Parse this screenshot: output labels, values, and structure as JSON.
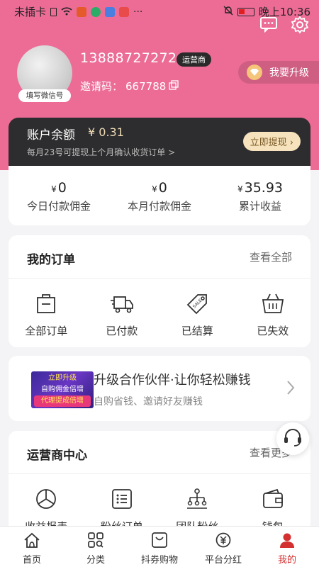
{
  "status": {
    "carrier": "未插卡",
    "battery_time": "晚上10:36"
  },
  "profile": {
    "wechat_tag": "填写微信号",
    "phone": "13888727272",
    "role": "运营商",
    "invite_label": "邀请码：",
    "invite_code": "667788",
    "upgrade_label": "我要升级"
  },
  "balance": {
    "title": "账户余额",
    "amount": "¥ 0.31",
    "note": "每月23号可提现上个月确认收货订单 >",
    "withdraw_label": "立即提现"
  },
  "earnings": [
    {
      "currency": "¥",
      "value": "0",
      "label": "今日付款佣金"
    },
    {
      "currency": "¥",
      "value": "0",
      "label": "本月付款佣金"
    },
    {
      "currency": "¥",
      "value": "35.93",
      "label": "累计收益"
    }
  ],
  "orders": {
    "title": "我的订单",
    "more": "查看全部",
    "items": [
      {
        "label": "全部订单",
        "icon": "bag-icon"
      },
      {
        "label": "已付款",
        "icon": "truck-icon"
      },
      {
        "label": "已结算",
        "icon": "sale-tag-icon"
      },
      {
        "label": "已失效",
        "icon": "basket-icon"
      }
    ]
  },
  "promo": {
    "img_line1": "立即升级",
    "img_line2": "自购佣金倍增",
    "img_line3": "代理提成倍增",
    "title": "升级合作伙伴·让你轻松赚钱",
    "subtitle": "自购省钱、邀请好友赚钱"
  },
  "operator": {
    "title": "运营商中心",
    "more": "查看更多",
    "items": [
      {
        "label": "收益报表",
        "icon": "pie-chart-icon"
      },
      {
        "label": "粉丝订单",
        "icon": "list-icon"
      },
      {
        "label": "团队粉丝",
        "icon": "team-tree-icon"
      },
      {
        "label": "钱包",
        "icon": "wallet-icon"
      }
    ]
  },
  "tabs": [
    {
      "label": "首页",
      "icon": "home-icon"
    },
    {
      "label": "分类",
      "icon": "category-icon"
    },
    {
      "label": "抖券购物",
      "icon": "shopping-bag-icon"
    },
    {
      "label": "平台分红",
      "icon": "dividend-icon"
    },
    {
      "label": "我的",
      "icon": "user-icon"
    }
  ],
  "colors": {
    "hero": "#ec6c96",
    "accent": "#d43030",
    "balance_bg": "#2d2d2f",
    "gold": "#f6e3bd"
  }
}
